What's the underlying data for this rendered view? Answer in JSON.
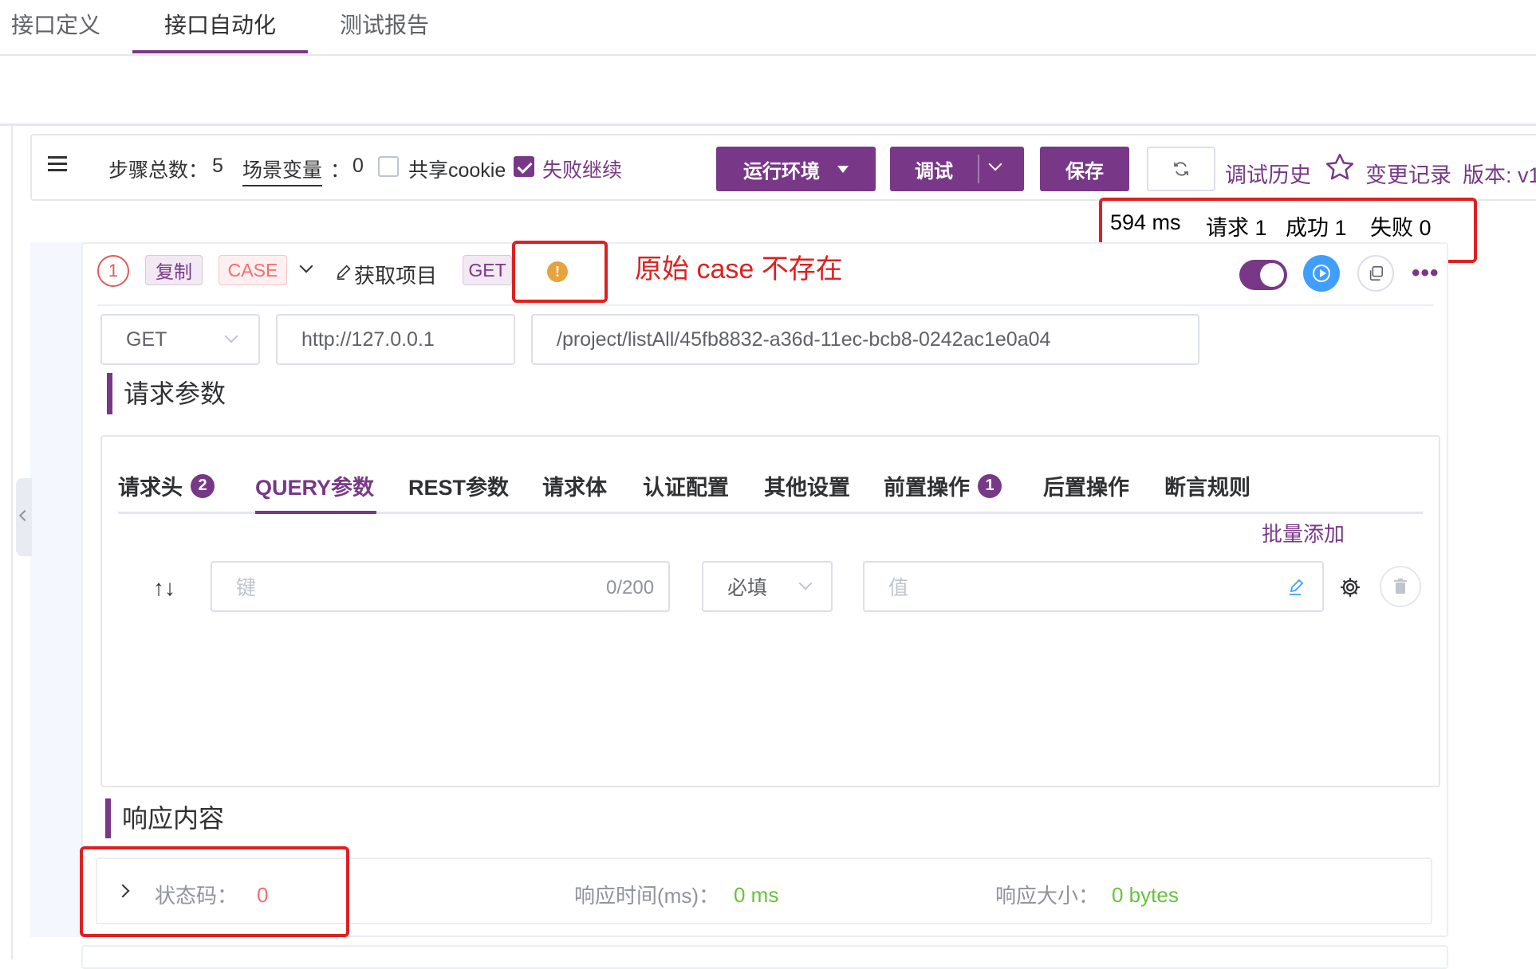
{
  "top_tabs": [
    "接口定义",
    "接口自动化",
    "测试报告"
  ],
  "toolbar": {
    "step_total_label": "步骤总数：",
    "step_total_value": "5",
    "scene_var_label": "场景变量",
    "scene_var_sep": "：",
    "scene_var_value": "0",
    "share_cookie_label": "共享cookie",
    "share_cookie_checked": false,
    "fail_continue_label": "失败继续",
    "fail_continue_checked": true,
    "env_button": "运行环境",
    "debug_button": "调试",
    "save_button": "保存",
    "debug_history": "调试历史",
    "change_record": "变更记录",
    "version_label": "版本: v1"
  },
  "stats": {
    "duration": "594 ms",
    "requests": "请求 1",
    "success": "成功 1",
    "fail": "失败 0"
  },
  "step": {
    "number": "1",
    "copy_tag": "复制",
    "case_tag": "CASE",
    "name": "获取项目",
    "method_tag": "GET",
    "warning_glyph": "!",
    "annotation": "原始 case 不存在",
    "enabled": true,
    "method": "GET",
    "domain": "http://127.0.0.1",
    "path": "/project/listAll/45fb8832-a36d-11ec-bcb8-0242ac1e0a04"
  },
  "request_params": {
    "title": "请求参数",
    "tabs": [
      {
        "label": "请求头",
        "badge": "2"
      },
      {
        "label": "QUERY参数",
        "badge": ""
      },
      {
        "label": "REST参数",
        "badge": ""
      },
      {
        "label": "请求体",
        "badge": ""
      },
      {
        "label": "认证配置",
        "badge": ""
      },
      {
        "label": "其他设置",
        "badge": ""
      },
      {
        "label": "前置操作",
        "badge": "1"
      },
      {
        "label": "后置操作",
        "badge": ""
      },
      {
        "label": "断言规则",
        "badge": ""
      }
    ],
    "active_tab": "QUERY参数",
    "batch_add": "批量添加",
    "sort_arrows": "↑↓",
    "key_placeholder": "键",
    "key_counter": "0/200",
    "required_select": "必填",
    "value_placeholder": "值"
  },
  "response": {
    "title": "响应内容",
    "status_label": "状态码：",
    "status_value": "0",
    "time_label": "响应时间(ms)：",
    "time_value": "0 ms",
    "size_label": "响应大小：",
    "size_value": "0 bytes"
  },
  "colors": {
    "primary": "#783887",
    "danger": "#f56c6c",
    "success": "#67c23a",
    "warning": "#e6a23c",
    "annotation_red": "#e02020"
  }
}
